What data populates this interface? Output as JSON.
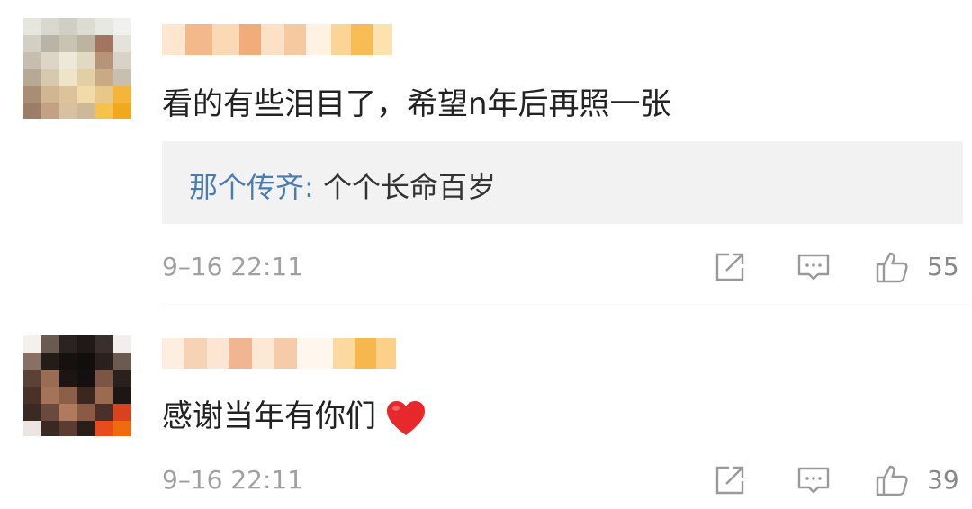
{
  "comments": [
    {
      "text": "看的有些泪目了，希望n年后再照一张",
      "reply": {
        "author": "那个传齐:",
        "text": " 个个长命百岁"
      },
      "timestamp": "9–16 22:11",
      "likes": "55"
    },
    {
      "text": "感谢当年有你们",
      "timestamp": "9–16 22:11",
      "likes": "39",
      "emoji": "heart-icon"
    }
  ],
  "icons": [
    "share-icon",
    "reply-icon",
    "like-icon",
    "heart-icon"
  ],
  "colors": {
    "reply_author": "#4a7cb4",
    "reply_background": "#f2f2f2",
    "timestamp": "#a0a0a0",
    "heart": "#e8292b",
    "icon": "#999999"
  }
}
